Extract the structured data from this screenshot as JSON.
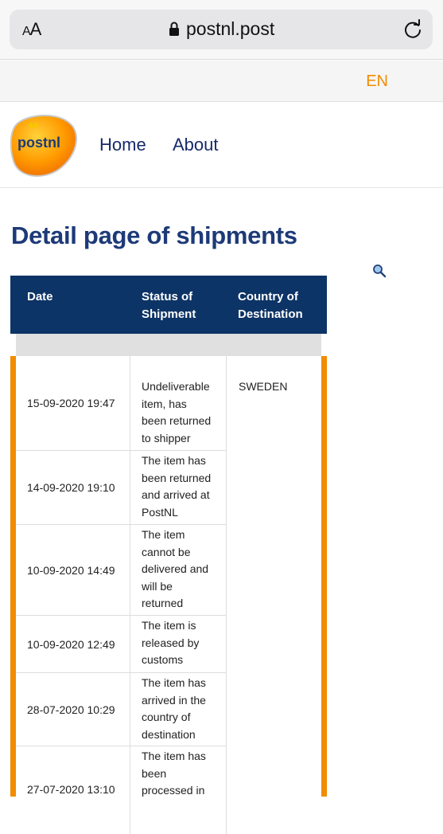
{
  "browser": {
    "aa_label_small": "A",
    "aa_label_large": "A",
    "url": "postnl.post"
  },
  "lang": {
    "current": "EN"
  },
  "nav": {
    "logo_text": "postnl",
    "home": "Home",
    "about": "About"
  },
  "page": {
    "title": "Detail page of shipments"
  },
  "table": {
    "headers": {
      "date": "Date",
      "status": "Status of\nShipment",
      "country": "Country of\nDestination"
    },
    "country": "SWEDEN",
    "rows": [
      {
        "date": "15-09-2020 19:47",
        "status": "Undeliverable\nitem, has\nbeen returned\nto shipper"
      },
      {
        "date": "14-09-2020 19:10",
        "status": "The item has\nbeen returned\nand arrived at\nPostNL"
      },
      {
        "date": "10-09-2020 14:49",
        "status": "The item\ncannot be\ndelivered and\nwill be\nreturned"
      },
      {
        "date": "10-09-2020 12:49",
        "status": "The item is\nreleased by\ncustoms"
      },
      {
        "date": "28-07-2020 10:29",
        "status": "The item has\narrived in the\ncountry of\ndestination"
      },
      {
        "date": "27-07-2020 13:10",
        "status": "The item has\nbeen\nprocessed in"
      }
    ]
  },
  "colors": {
    "brand_orange": "#f28c00",
    "nav_blue": "#162a6b",
    "header_blue": "#0d3466"
  }
}
